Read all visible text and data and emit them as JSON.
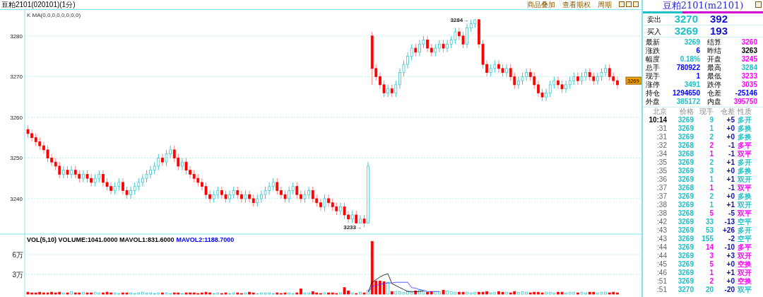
{
  "window": {
    "title": "豆粕2101(020101)(1分)",
    "menu": [
      "商品叠加",
      "查看期权",
      "周期"
    ]
  },
  "price_chart": {
    "indicator": "K  MA(0,0,0,0,0,0,0,0)",
    "high_label": "3284→",
    "low_label": "3233→",
    "last_price_tag": "3269",
    "chart_data": {
      "type": "candlestick",
      "yticks": [
        {
          "value": 3280,
          "label": "3280"
        },
        {
          "value": 3270,
          "label": "3270"
        },
        {
          "value": 3260,
          "label": "3260"
        },
        {
          "value": 3250,
          "label": "3250"
        },
        {
          "value": 3240,
          "label": "3240"
        }
      ],
      "ylim": [
        3231.3,
        3286.4
      ],
      "grid": true,
      "ohlc": [
        [
          3257,
          3258,
          3255,
          3256
        ],
        [
          3256,
          3257,
          3254,
          3255
        ],
        [
          3255,
          3256,
          3253,
          3254
        ],
        [
          3254,
          3255,
          3252,
          3253
        ],
        [
          3253,
          3254,
          3251,
          3252
        ],
        [
          3252,
          3253,
          3249,
          3250
        ],
        [
          3250,
          3251,
          3248,
          3249
        ],
        [
          3249,
          3250,
          3247,
          3248
        ],
        [
          3248,
          3249,
          3245,
          3246
        ],
        [
          3246,
          3248,
          3245,
          3247
        ],
        [
          3247,
          3248,
          3245,
          3246
        ],
        [
          3246,
          3248,
          3245,
          3247
        ],
        [
          3247,
          3248,
          3245,
          3246
        ],
        [
          3246,
          3247,
          3244,
          3245
        ],
        [
          3245,
          3247,
          3244,
          3246
        ],
        [
          3246,
          3247,
          3244,
          3245
        ],
        [
          3245,
          3246,
          3243,
          3244
        ],
        [
          3244,
          3246,
          3243,
          3245
        ],
        [
          3245,
          3247,
          3244,
          3246
        ],
        [
          3246,
          3247,
          3243,
          3244
        ],
        [
          3244,
          3245,
          3242,
          3243
        ],
        [
          3243,
          3244,
          3241,
          3242
        ],
        [
          3242,
          3244,
          3241,
          3243
        ],
        [
          3243,
          3245,
          3242,
          3244
        ],
        [
          3244,
          3245,
          3241,
          3242
        ],
        [
          3242,
          3243,
          3240,
          3241
        ],
        [
          3241,
          3243,
          3240,
          3242
        ],
        [
          3242,
          3244,
          3241,
          3243
        ],
        [
          3243,
          3245,
          3242,
          3244
        ],
        [
          3244,
          3246,
          3243,
          3245
        ],
        [
          3245,
          3247,
          3244,
          3246
        ],
        [
          3246,
          3248,
          3245,
          3247
        ],
        [
          3247,
          3249,
          3246,
          3248
        ],
        [
          3248,
          3251,
          3247,
          3250
        ],
        [
          3250,
          3251,
          3248,
          3249
        ],
        [
          3249,
          3252,
          3248,
          3251
        ],
        [
          3251,
          3253,
          3250,
          3252
        ],
        [
          3252,
          3253,
          3249,
          3250
        ],
        [
          3250,
          3251,
          3247,
          3248
        ],
        [
          3248,
          3250,
          3247,
          3249
        ],
        [
          3249,
          3250,
          3246,
          3247
        ],
        [
          3247,
          3248,
          3245,
          3246
        ],
        [
          3246,
          3247,
          3244,
          3245
        ],
        [
          3245,
          3246,
          3243,
          3244
        ],
        [
          3244,
          3245,
          3242,
          3243
        ],
        [
          3243,
          3244,
          3240,
          3241
        ],
        [
          3241,
          3242,
          3239,
          3240
        ],
        [
          3240,
          3242,
          3239,
          3241
        ],
        [
          3241,
          3243,
          3240,
          3242
        ],
        [
          3242,
          3243,
          3240,
          3241
        ],
        [
          3241,
          3242,
          3239,
          3240
        ],
        [
          3240,
          3242,
          3239,
          3241
        ],
        [
          3241,
          3243,
          3240,
          3242
        ],
        [
          3242,
          3243,
          3240,
          3241
        ],
        [
          3241,
          3242,
          3239,
          3240
        ],
        [
          3240,
          3242,
          3239,
          3241
        ],
        [
          3241,
          3242,
          3239,
          3240
        ],
        [
          3240,
          3241,
          3238,
          3239
        ],
        [
          3239,
          3241,
          3238,
          3240
        ],
        [
          3240,
          3242,
          3239,
          3241
        ],
        [
          3241,
          3243,
          3240,
          3242
        ],
        [
          3242,
          3244,
          3241,
          3243
        ],
        [
          3243,
          3245,
          3242,
          3244
        ],
        [
          3244,
          3245,
          3241,
          3242
        ],
        [
          3242,
          3243,
          3240,
          3241
        ],
        [
          3241,
          3242,
          3239,
          3240
        ],
        [
          3240,
          3243,
          3239,
          3242
        ],
        [
          3242,
          3244,
          3241,
          3243
        ],
        [
          3243,
          3244,
          3240,
          3241
        ],
        [
          3241,
          3242,
          3239,
          3240
        ],
        [
          3240,
          3242,
          3239,
          3241
        ],
        [
          3241,
          3243,
          3240,
          3242
        ],
        [
          3242,
          3243,
          3239,
          3240
        ],
        [
          3240,
          3241,
          3238,
          3239
        ],
        [
          3239,
          3240,
          3237,
          3238
        ],
        [
          3238,
          3241,
          3237,
          3240
        ],
        [
          3240,
          3241,
          3238,
          3239
        ],
        [
          3239,
          3240,
          3237,
          3238
        ],
        [
          3238,
          3239,
          3236,
          3237
        ],
        [
          3237,
          3239,
          3236,
          3238
        ],
        [
          3238,
          3239,
          3235,
          3236
        ],
        [
          3236,
          3237,
          3234,
          3235
        ],
        [
          3235,
          3237,
          3234,
          3236
        ],
        [
          3236,
          3237,
          3234,
          3234
        ],
        [
          3234,
          3236,
          3234,
          3235
        ],
        [
          3235,
          3236,
          3233,
          3234
        ],
        [
          3234,
          3249,
          3234,
          3248
        ],
        [
          3280,
          3281,
          3268,
          3272
        ],
        [
          3272,
          3273,
          3269,
          3270
        ],
        [
          3270,
          3271,
          3267,
          3268
        ],
        [
          3268,
          3269,
          3265,
          3266
        ],
        [
          3266,
          3268,
          3265,
          3267
        ],
        [
          3267,
          3268,
          3265,
          3266
        ],
        [
          3266,
          3269,
          3265,
          3268
        ],
        [
          3268,
          3272,
          3267,
          3271
        ],
        [
          3271,
          3274,
          3270,
          3273
        ],
        [
          3273,
          3276,
          3272,
          3275
        ],
        [
          3275,
          3278,
          3274,
          3277
        ],
        [
          3277,
          3278,
          3275,
          3276
        ],
        [
          3276,
          3279,
          3275,
          3278
        ],
        [
          3278,
          3280,
          3277,
          3279
        ],
        [
          3279,
          3280,
          3276,
          3277
        ],
        [
          3277,
          3278,
          3275,
          3276
        ],
        [
          3276,
          3278,
          3275,
          3277
        ],
        [
          3277,
          3279,
          3276,
          3278
        ],
        [
          3278,
          3279,
          3276,
          3277
        ],
        [
          3277,
          3279,
          3276,
          3278
        ],
        [
          3278,
          3280,
          3277,
          3279
        ],
        [
          3279,
          3282,
          3278,
          3281
        ],
        [
          3281,
          3282,
          3279,
          3280
        ],
        [
          3280,
          3281,
          3277,
          3278
        ],
        [
          3278,
          3283,
          3277,
          3282
        ],
        [
          3282,
          3284,
          3281,
          3283
        ],
        [
          3283,
          3284,
          3282,
          3284
        ],
        [
          3284,
          3284,
          3277,
          3278
        ],
        [
          3278,
          3279,
          3272,
          3273
        ],
        [
          3273,
          3274,
          3270,
          3271
        ],
        [
          3271,
          3273,
          3270,
          3272
        ],
        [
          3272,
          3274,
          3271,
          3273
        ],
        [
          3273,
          3274,
          3271,
          3272
        ],
        [
          3272,
          3273,
          3270,
          3271
        ],
        [
          3271,
          3273,
          3270,
          3272
        ],
        [
          3272,
          3273,
          3269,
          3270
        ],
        [
          3270,
          3271,
          3267,
          3268
        ],
        [
          3268,
          3270,
          3267,
          3269
        ],
        [
          3269,
          3271,
          3268,
          3270
        ],
        [
          3270,
          3272,
          3269,
          3271
        ],
        [
          3271,
          3272,
          3269,
          3270
        ],
        [
          3270,
          3271,
          3267,
          3268
        ],
        [
          3268,
          3269,
          3265,
          3266
        ],
        [
          3266,
          3267,
          3264,
          3265
        ],
        [
          3265,
          3267,
          3264,
          3266
        ],
        [
          3266,
          3269,
          3265,
          3268
        ],
        [
          3268,
          3270,
          3267,
          3269
        ],
        [
          3269,
          3270,
          3267,
          3268
        ],
        [
          3268,
          3269,
          3266,
          3267
        ],
        [
          3267,
          3269,
          3266,
          3268
        ],
        [
          3268,
          3270,
          3267,
          3269
        ],
        [
          3269,
          3271,
          3268,
          3270
        ],
        [
          3270,
          3271,
          3268,
          3269
        ],
        [
          3269,
          3271,
          3268,
          3270
        ],
        [
          3270,
          3272,
          3269,
          3271
        ],
        [
          3271,
          3272,
          3269,
          3270
        ],
        [
          3270,
          3271,
          3268,
          3269
        ],
        [
          3269,
          3271,
          3268,
          3270
        ],
        [
          3270,
          3272,
          3269,
          3271
        ],
        [
          3271,
          3273,
          3270,
          3272
        ],
        [
          3272,
          3273,
          3269,
          3270
        ],
        [
          3270,
          3271,
          3268,
          3269
        ],
        [
          3269,
          3270,
          3267,
          3268
        ]
      ]
    }
  },
  "volume_chart": {
    "indicators": [
      {
        "text": "VOL(5,10) VOLUME:1041.0000 MAVOL1:831.6000",
        "color": "#000000"
      },
      {
        "text": "MAVOL2:1188.7000",
        "color": "#0000ff"
      }
    ],
    "chart_data": {
      "type": "bar",
      "ylim": [
        0,
        9
      ],
      "grid": true,
      "yticks": [
        {
          "value": 6,
          "label": "6万"
        },
        {
          "value": 3,
          "label": "3万"
        }
      ],
      "series": [
        {
          "type": "bar",
          "colors": [
            "#ff0000",
            "#ff0000",
            "#ff0000",
            "#ff0000",
            "#ff0000",
            "#ff0000",
            "#ff0000",
            "#ff0000",
            "#ff0000",
            "#40c8d0",
            "#ff0000",
            "#40c8d0",
            "#ff0000",
            "#ff0000",
            "#40c8d0",
            "#ff0000",
            "#ff0000",
            "#40c8d0",
            "#40c8d0",
            "#ff0000",
            "#ff0000",
            "#ff0000",
            "#40c8d0",
            "#40c8d0",
            "#ff0000",
            "#ff0000",
            "#40c8d0",
            "#40c8d0",
            "#40c8d0",
            "#40c8d0",
            "#40c8d0",
            "#40c8d0",
            "#40c8d0",
            "#40c8d0",
            "#ff0000",
            "#40c8d0",
            "#40c8d0",
            "#ff0000",
            "#ff0000",
            "#40c8d0",
            "#ff0000",
            "#ff0000",
            "#ff0000",
            "#ff0000",
            "#ff0000",
            "#ff0000",
            "#ff0000",
            "#40c8d0",
            "#40c8d0",
            "#ff0000",
            "#ff0000",
            "#40c8d0",
            "#40c8d0",
            "#ff0000",
            "#ff0000",
            "#40c8d0",
            "#ff0000",
            "#ff0000",
            "#40c8d0",
            "#40c8d0",
            "#40c8d0",
            "#40c8d0",
            "#40c8d0",
            "#ff0000",
            "#ff0000",
            "#ff0000",
            "#40c8d0",
            "#40c8d0",
            "#ff0000",
            "#ff0000",
            "#40c8d0",
            "#40c8d0",
            "#ff0000",
            "#ff0000",
            "#ff0000",
            "#40c8d0",
            "#ff0000",
            "#ff0000",
            "#ff0000",
            "#40c8d0",
            "#ff0000",
            "#ff0000",
            "#40c8d0",
            "#ff0000",
            "#40c8d0",
            "#ff0000",
            "#40c8d0",
            "#ff0000",
            "#ff0000",
            "#ff0000",
            "#ff0000",
            "#40c8d0",
            "#ff0000",
            "#40c8d0",
            "#40c8d0",
            "#40c8d0",
            "#40c8d0",
            "#40c8d0",
            "#ff0000",
            "#40c8d0",
            "#40c8d0",
            "#ff0000",
            "#ff0000",
            "#40c8d0",
            "#40c8d0",
            "#ff0000",
            "#40c8d0",
            "#40c8d0",
            "#40c8d0",
            "#ff0000",
            "#ff0000",
            "#40c8d0",
            "#40c8d0",
            "#40c8d0",
            "#ff0000",
            "#ff0000",
            "#ff0000",
            "#40c8d0",
            "#40c8d0",
            "#ff0000",
            "#ff0000",
            "#40c8d0",
            "#ff0000",
            "#ff0000",
            "#40c8d0",
            "#40c8d0",
            "#40c8d0",
            "#ff0000",
            "#ff0000",
            "#ff0000",
            "#ff0000",
            "#40c8d0",
            "#40c8d0",
            "#40c8d0",
            "#ff0000",
            "#ff0000",
            "#40c8d0",
            "#40c8d0",
            "#40c8d0",
            "#ff0000",
            "#40c8d0",
            "#40c8d0",
            "#ff0000",
            "#ff0000",
            "#40c8d0",
            "#40c8d0",
            "#40c8d0",
            "#ff0000",
            "#ff0000",
            "#ff0000"
          ],
          "values": [
            0.3,
            0.2,
            0.2,
            0.3,
            0.2,
            0.2,
            0.3,
            0.2,
            0.3,
            0.2,
            0.2,
            0.4,
            0.2,
            0.2,
            0.3,
            0.2,
            0.2,
            0.3,
            0.2,
            0.2,
            0.3,
            0.2,
            0.2,
            0.1,
            0.2,
            0.2,
            0.2,
            0.1,
            0.2,
            0.3,
            0.2,
            0.2,
            0.1,
            0.2,
            0.2,
            0.2,
            0.1,
            0.2,
            0.2,
            0.1,
            0.2,
            0.2,
            0.2,
            0.1,
            0.2,
            0.3,
            0.2,
            0.1,
            0.2,
            0.1,
            0.2,
            0.1,
            0.2,
            0.2,
            0.1,
            0.2,
            0.3,
            0.2,
            0.1,
            0.2,
            0.2,
            0.2,
            0.1,
            0.2,
            0.1,
            0.2,
            0.2,
            0.1,
            0.2,
            0.8,
            0.2,
            0.2,
            0.4,
            0.2,
            0.1,
            0.2,
            0.2,
            0.2,
            0.1,
            0.2,
            1.0,
            0.5,
            0.2,
            0.1,
            0.3,
            0.2,
            0.6,
            8.0,
            2.0,
            2.0,
            1.9,
            1.8,
            0.4,
            0.4,
            0.4,
            0.3,
            0.5,
            0.3,
            0.5,
            0.6,
            0.4,
            0.3,
            0.4,
            0.4,
            0.4,
            0.6,
            0.5,
            0.4,
            0.3,
            0.3,
            0.3,
            0.3,
            0.2,
            0.3,
            0.3,
            0.3,
            0.4,
            0.2,
            0.3,
            0.4,
            0.3,
            0.3,
            0.2,
            0.4,
            0.3,
            0.4,
            0.3,
            0.2,
            0.3,
            0.3,
            0.2,
            0.3,
            0.3,
            0.2,
            0.3,
            0.3,
            0.2,
            0.3,
            0.3,
            0.2,
            0.3,
            0.2,
            0.3,
            0.3,
            0.2,
            0.3,
            0.3,
            0.2,
            0.3,
            0.2
          ]
        },
        {
          "type": "line",
          "color": "#000000",
          "values": [
            null,
            null,
            null,
            null,
            null,
            null,
            null,
            null,
            null,
            null,
            null,
            null,
            null,
            null,
            null,
            null,
            null,
            null,
            null,
            null,
            null,
            null,
            null,
            null,
            null,
            null,
            null,
            null,
            null,
            null,
            null,
            null,
            null,
            null,
            null,
            null,
            null,
            null,
            null,
            null,
            null,
            null,
            null,
            null,
            null,
            null,
            null,
            null,
            null,
            null,
            null,
            null,
            null,
            null,
            null,
            null,
            null,
            null,
            null,
            null,
            null,
            null,
            null,
            null,
            null,
            null,
            null,
            null,
            null,
            null,
            null,
            null,
            null,
            null,
            null,
            null,
            null,
            null,
            null,
            null,
            null,
            null,
            null,
            null,
            null,
            null,
            0.3,
            1.8,
            2.2,
            2.6,
            2.9,
            3.1,
            1.6,
            1.3,
            1.0,
            0.7,
            0.4,
            0.4,
            0.4,
            0.4,
            0.5,
            null,
            null,
            null,
            null,
            null,
            null,
            null,
            null,
            null,
            null,
            null,
            null,
            null,
            null,
            null,
            null,
            null,
            null,
            null,
            null,
            null,
            null,
            null,
            null,
            null,
            null,
            null,
            null,
            null,
            null,
            null,
            null,
            null,
            null,
            null,
            null,
            null,
            null,
            null,
            null,
            null,
            null,
            null,
            null
          ]
        },
        {
          "type": "line",
          "color": "#3030ff",
          "values": [
            null,
            null,
            null,
            null,
            null,
            null,
            null,
            null,
            null,
            null,
            null,
            null,
            null,
            null,
            null,
            null,
            null,
            null,
            null,
            null,
            null,
            null,
            null,
            null,
            null,
            null,
            null,
            null,
            null,
            null,
            null,
            null,
            null,
            null,
            null,
            null,
            null,
            null,
            null,
            null,
            null,
            null,
            null,
            null,
            null,
            null,
            null,
            null,
            null,
            null,
            null,
            null,
            null,
            null,
            null,
            null,
            null,
            null,
            null,
            null,
            null,
            null,
            null,
            null,
            null,
            null,
            null,
            null,
            null,
            null,
            null,
            null,
            null,
            null,
            null,
            null,
            null,
            null,
            null,
            null,
            null,
            null,
            null,
            null,
            null,
            null,
            0.3,
            1.1,
            1.3,
            1.5,
            1.6,
            1.7,
            1.7,
            1.8,
            1.8,
            1.8,
            1.8,
            1.0,
            0.9,
            0.7,
            0.6,
            0.4,
            0.4,
            0.4,
            0.4,
            null,
            null,
            null,
            null,
            null,
            null,
            null,
            null,
            null,
            null,
            null,
            null,
            null,
            null,
            null,
            null,
            null,
            null,
            null,
            null,
            null,
            null,
            null,
            null,
            null,
            null,
            null,
            null,
            null,
            null,
            null,
            null,
            null,
            null,
            null,
            null
          ]
        }
      ]
    }
  },
  "quote_panel": {
    "title": "豆粕2101(m2101)",
    "ratio_bar": {
      "level": 0.33
    },
    "book": [
      {
        "label": "卖出",
        "price": "3270",
        "volume": "392"
      },
      {
        "label": "买入",
        "price": "3269",
        "volume": "193"
      }
    ],
    "stats": [
      {
        "label": "最新",
        "value": "3269",
        "color": "#20c0c8"
      },
      {
        "label": "结算",
        "value": "3260",
        "color": "#ff00ff"
      },
      {
        "label": "涨跌",
        "value": "6",
        "color": "#0000ff"
      },
      {
        "label": "昨结",
        "value": "3263",
        "color": "#000000"
      },
      {
        "label": "幅度",
        "value": "0.18%",
        "color": "#20c0c8"
      },
      {
        "label": "开盘",
        "value": "3245",
        "color": "#ff00ff"
      },
      {
        "label": "总手",
        "value": "780922",
        "color": "#0000ff"
      },
      {
        "label": "最高",
        "value": "3284",
        "color": "#20c0c8"
      },
      {
        "label": "现手",
        "value": "1",
        "color": "#0000ff"
      },
      {
        "label": "最低",
        "value": "3233",
        "color": "#ff00ff"
      },
      {
        "label": "涨停",
        "value": "3491",
        "color": "#20c0c8"
      },
      {
        "label": "跌停",
        "value": "3035",
        "color": "#ff00ff"
      },
      {
        "label": "持仓",
        "value": "1294650",
        "color": "#0000ff"
      },
      {
        "label": "仓差",
        "value": "-25146",
        "color": "#0000ff"
      },
      {
        "label": "外盘",
        "value": "385172",
        "color": "#20c0c8"
      },
      {
        "label": "内盘",
        "value": "395750",
        "color": "#ff00ff"
      }
    ],
    "ticks": {
      "columns": [
        "北京",
        "价格",
        "现手",
        "仓差",
        "性质"
      ],
      "rows": [
        {
          "time": "10:14",
          "price": {
            "text": "3269",
            "color": "#20c0c8"
          },
          "volume": {
            "text": "9",
            "color": "#20c0c8"
          },
          "change": "+5",
          "nature": {
            "text": "多开",
            "color": "#20c0c8"
          }
        },
        {
          "time": ":31",
          "price": {
            "text": "3269",
            "color": "#20c0c8"
          },
          "volume": {
            "text": "1",
            "color": "#20c0c8"
          },
          "change": "+0",
          "nature": {
            "text": "多换",
            "color": "#20c0c8"
          }
        },
        {
          "time": ":31",
          "price": {
            "text": "3269",
            "color": "#20c0c8"
          },
          "volume": {
            "text": "2",
            "color": "#20c0c8"
          },
          "change": "+0",
          "nature": {
            "text": "多换",
            "color": "#20c0c8"
          }
        },
        {
          "time": ":32",
          "price": {
            "text": "3268",
            "color": "#20c0c8"
          },
          "volume": {
            "text": "2",
            "color": "#ff00ff"
          },
          "change": "-1",
          "nature": {
            "text": "多平",
            "color": "#ff00ff"
          }
        },
        {
          "time": ":34",
          "price": {
            "text": "3268",
            "color": "#20c0c8"
          },
          "volume": {
            "text": "1",
            "color": "#ff00ff"
          },
          "change": "-1",
          "nature": {
            "text": "双平",
            "color": "#ff00ff"
          }
        },
        {
          "time": ":35",
          "price": {
            "text": "3269",
            "color": "#20c0c8"
          },
          "volume": {
            "text": "2",
            "color": "#20c0c8"
          },
          "change": "+1",
          "nature": {
            "text": "多开",
            "color": "#20c0c8"
          }
        },
        {
          "time": ":35",
          "price": {
            "text": "3269",
            "color": "#20c0c8"
          },
          "volume": {
            "text": "3",
            "color": "#20c0c8"
          },
          "change": "+0",
          "nature": {
            "text": "多换",
            "color": "#20c0c8"
          }
        },
        {
          "time": ":36",
          "price": {
            "text": "3269",
            "color": "#20c0c8"
          },
          "volume": {
            "text": "1",
            "color": "#20c0c8"
          },
          "change": "+1",
          "nature": {
            "text": "双开",
            "color": "#20c0c8"
          }
        },
        {
          "time": ":37",
          "price": {
            "text": "3268",
            "color": "#20c0c8"
          },
          "volume": {
            "text": "1",
            "color": "#ff00ff"
          },
          "change": "-1",
          "nature": {
            "text": "双平",
            "color": "#ff00ff"
          }
        },
        {
          "time": ":37",
          "price": {
            "text": "3269",
            "color": "#20c0c8"
          },
          "volume": {
            "text": "2",
            "color": "#20c0c8"
          },
          "change": "+0",
          "nature": {
            "text": "多换",
            "color": "#20c0c8"
          }
        },
        {
          "time": ":38",
          "price": {
            "text": "3269",
            "color": "#20c0c8"
          },
          "volume": {
            "text": "1",
            "color": "#20c0c8"
          },
          "change": "+1",
          "nature": {
            "text": "双开",
            "color": "#20c0c8"
          }
        },
        {
          "time": ":38",
          "price": {
            "text": "3268",
            "color": "#20c0c8"
          },
          "volume": {
            "text": "5",
            "color": "#ff00ff"
          },
          "change": "-5",
          "nature": {
            "text": "双平",
            "color": "#ff00ff"
          }
        },
        {
          "time": ":42",
          "price": {
            "text": "3269",
            "color": "#20c0c8"
          },
          "volume": {
            "text": "33",
            "color": "#20c0c8"
          },
          "change": "-13",
          "nature": {
            "text": "空平",
            "color": "#20c0c8"
          }
        },
        {
          "time": ":43",
          "price": {
            "text": "3269",
            "color": "#20c0c8"
          },
          "volume": {
            "text": "53",
            "color": "#20c0c8"
          },
          "change": "+26",
          "nature": {
            "text": "多开",
            "color": "#20c0c8"
          }
        },
        {
          "time": ":43",
          "price": {
            "text": "3269",
            "color": "#20c0c8"
          },
          "volume": {
            "text": "155",
            "color": "#20c0c8"
          },
          "change": "-2",
          "nature": {
            "text": "空平",
            "color": "#20c0c8"
          }
        },
        {
          "time": ":44",
          "price": {
            "text": "3269",
            "color": "#20c0c8"
          },
          "volume": {
            "text": "14",
            "color": "#ff00ff"
          },
          "change": "-10",
          "nature": {
            "text": "多平",
            "color": "#ff00ff"
          }
        },
        {
          "time": ":44",
          "price": {
            "text": "3269",
            "color": "#20c0c8"
          },
          "volume": {
            "text": "3",
            "color": "#ff00ff"
          },
          "change": "+3",
          "nature": {
            "text": "双开",
            "color": "#ff00ff"
          }
        },
        {
          "time": ":45",
          "price": {
            "text": "3269",
            "color": "#20c0c8"
          },
          "volume": {
            "text": "5",
            "color": "#ff00ff"
          },
          "change": "+0",
          "nature": {
            "text": "空换",
            "color": "#ff00ff"
          }
        },
        {
          "time": ":46",
          "price": {
            "text": "3269",
            "color": "#20c0c8"
          },
          "volume": {
            "text": "1",
            "color": "#ff00ff"
          },
          "change": "+1",
          "nature": {
            "text": "双开",
            "color": "#ff00ff"
          }
        },
        {
          "time": ":51",
          "price": {
            "text": "3269",
            "color": "#20c0c8"
          },
          "volume": {
            "text": "2",
            "color": "#ff00ff"
          },
          "change": "+0",
          "nature": {
            "text": "空换",
            "color": "#ff00ff"
          }
        },
        {
          "time": ":51",
          "price": {
            "text": "3270",
            "color": "#20c0c8"
          },
          "volume": {
            "text": "20",
            "color": "#20c0c8"
          },
          "change": "-20",
          "nature": {
            "text": "双平",
            "color": "#20c0c8"
          }
        }
      ]
    }
  }
}
